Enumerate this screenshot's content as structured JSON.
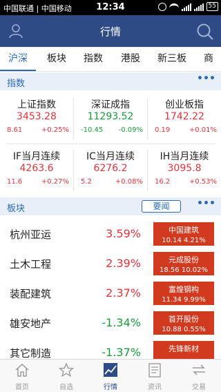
{
  "status_bar": {
    "carrier": "中国联通 | 中国移动",
    "time": "12:34",
    "battery": "55"
  },
  "header": {
    "title": "行情"
  },
  "tabs": [
    "沪深",
    "板块",
    "指数",
    "港股",
    "新三板",
    "商品"
  ],
  "active_tab": "沪深",
  "index_section": {
    "label": "指数"
  },
  "indices": [
    {
      "name": "上证指数",
      "value": "3453.28",
      "change": "8.61",
      "pct": "+0.25%",
      "dir": "up"
    },
    {
      "name": "深证成指",
      "value": "11293.52",
      "change": "-10.45",
      "pct": "-0.09%",
      "dir": "down"
    },
    {
      "name": "创业板指",
      "value": "1742.22",
      "change": "0.19",
      "pct": "+0.01%",
      "dir": "up"
    },
    {
      "name": "IF当月连续",
      "value": "4263.6",
      "change": "11.6",
      "pct": "+0.27%",
      "dir": "up"
    },
    {
      "name": "IC当月连续",
      "value": "6276.2",
      "change": "5.2",
      "pct": "+0.08%",
      "dir": "up"
    },
    {
      "name": "IH当月连续",
      "value": "3095.8",
      "change": "16.2",
      "pct": "+0.53%",
      "dir": "up"
    }
  ],
  "sector_section": {
    "label": "板块",
    "news_button": "要闻"
  },
  "sectors": [
    {
      "name": "杭州亚运",
      "pct": "3.59%",
      "dir": "up",
      "leader": "中国建筑",
      "leader_stat": "10.14 4.21%"
    },
    {
      "name": "土木工程",
      "pct": "2.39%",
      "dir": "up",
      "leader": "元成股份",
      "leader_stat": "18.56 10.02%"
    },
    {
      "name": "装配建筑",
      "pct": "2.37%",
      "dir": "up",
      "leader": "富煌钢构",
      "leader_stat": "11.34 9.99%"
    },
    {
      "name": "雄安地产",
      "pct": "-1.34%",
      "dir": "down",
      "leader": "首开股份",
      "leader_stat": "10.88 0.55%"
    },
    {
      "name": "其它制造",
      "pct": "-1.37%",
      "dir": "down",
      "leader": "先锋新材",
      "leader_stat": ""
    }
  ],
  "bottom_nav": [
    {
      "label": "首页",
      "icon": "home-icon"
    },
    {
      "label": "自选",
      "icon": "star-icon"
    },
    {
      "label": "行情",
      "icon": "chart-icon"
    },
    {
      "label": "资讯",
      "icon": "document-icon"
    },
    {
      "label": "交易",
      "icon": "transfer-icon"
    }
  ],
  "active_nav": "行情",
  "colors": {
    "header": "#2e4b85",
    "accent": "#2a6ab4",
    "up": "#e0343a",
    "down": "#1a9a3a",
    "leader_box": "#d23a1f"
  }
}
